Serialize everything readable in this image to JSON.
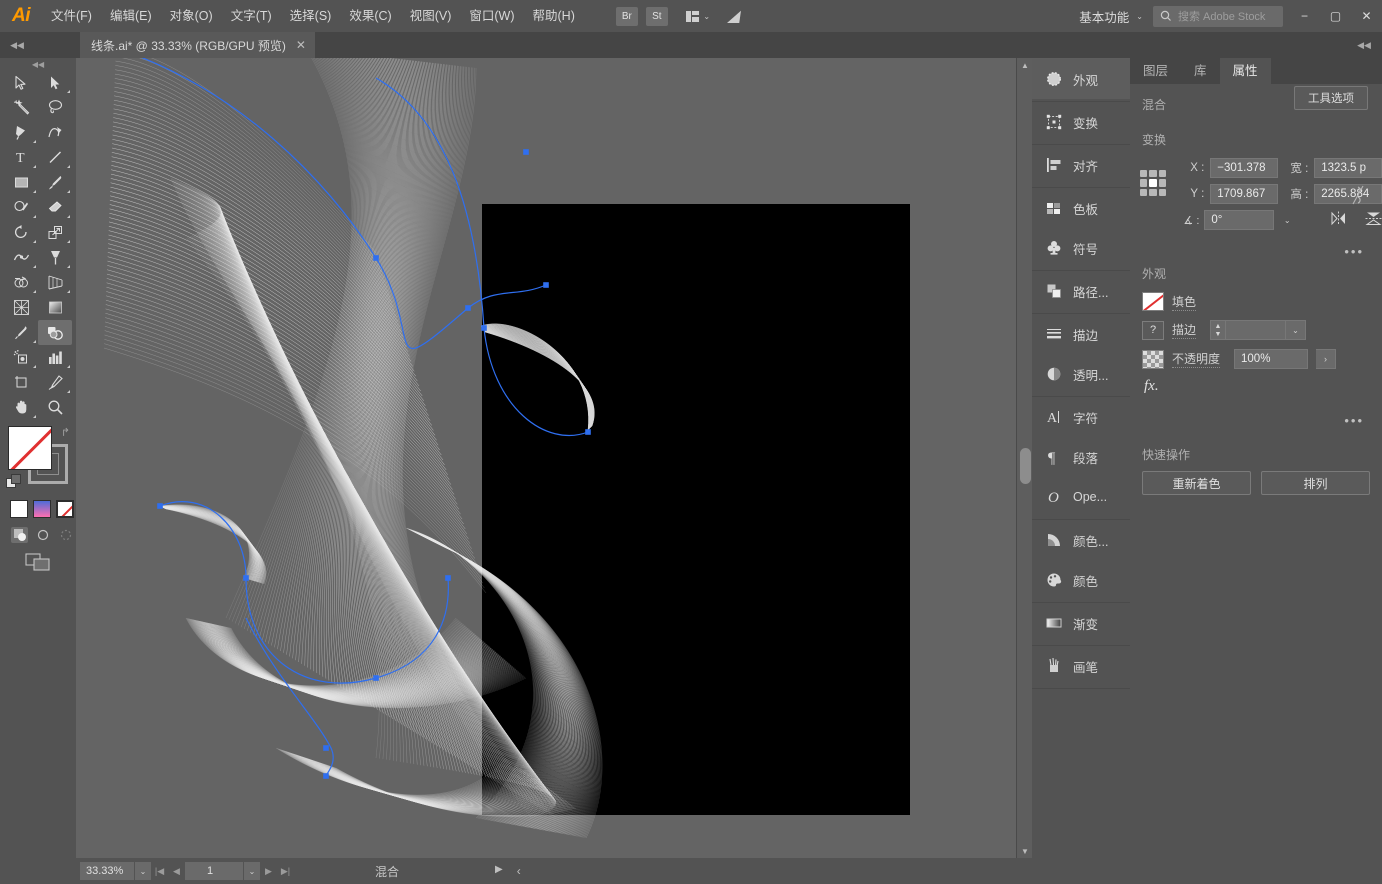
{
  "app": {
    "logo": "Ai"
  },
  "menubar": {
    "items": [
      {
        "label": "文件(F)"
      },
      {
        "label": "编辑(E)"
      },
      {
        "label": "对象(O)"
      },
      {
        "label": "文字(T)"
      },
      {
        "label": "选择(S)"
      },
      {
        "label": "效果(C)"
      },
      {
        "label": "视图(V)"
      },
      {
        "label": "窗口(W)"
      },
      {
        "label": "帮助(H)"
      }
    ],
    "bridge_label": "Br",
    "stock_label": "St",
    "workspace": "基本功能",
    "search_placeholder": "搜索 Adobe Stock",
    "win_minimize": "−",
    "win_maximize": "▢",
    "win_close": "✕"
  },
  "tabbar": {
    "collapse_left": "◀◀",
    "collapse_right": "◀◀",
    "document_title": "线条.ai* @ 33.33% (RGB/GPU 预览)",
    "close_label": "✕"
  },
  "toolbar": {
    "collapse": "◀◀",
    "tools": [
      {
        "name": "selection-tool",
        "glyph": "arrow-solid-nw",
        "submenu": false,
        "selected": false
      },
      {
        "name": "direct-selection-tool",
        "glyph": "arrow-filled",
        "submenu": true,
        "selected": false
      },
      {
        "name": "magic-wand-tool",
        "glyph": "wand",
        "submenu": false,
        "selected": false
      },
      {
        "name": "lasso-tool",
        "glyph": "lasso",
        "submenu": false,
        "selected": false
      },
      {
        "name": "pen-tool",
        "glyph": "pen",
        "submenu": true,
        "selected": false
      },
      {
        "name": "curvature-tool",
        "glyph": "curvature",
        "submenu": false,
        "selected": false
      },
      {
        "name": "type-tool",
        "glyph": "type",
        "submenu": true,
        "selected": false
      },
      {
        "name": "line-segment-tool",
        "glyph": "line",
        "submenu": true,
        "selected": false
      },
      {
        "name": "rectangle-tool",
        "glyph": "rect",
        "submenu": true,
        "selected": false
      },
      {
        "name": "paintbrush-tool",
        "glyph": "brush",
        "submenu": true,
        "selected": false
      },
      {
        "name": "shaper-tool",
        "glyph": "shaper",
        "submenu": true,
        "selected": false
      },
      {
        "name": "eraser-tool",
        "glyph": "eraser",
        "submenu": true,
        "selected": false
      },
      {
        "name": "rotate-tool",
        "glyph": "rotate",
        "submenu": true,
        "selected": false
      },
      {
        "name": "scale-tool",
        "glyph": "scale",
        "submenu": true,
        "selected": false
      },
      {
        "name": "width-tool",
        "glyph": "width",
        "submenu": true,
        "selected": false
      },
      {
        "name": "free-transform-tool",
        "glyph": "pushpin",
        "submenu": true,
        "selected": false
      },
      {
        "name": "shape-builder-tool",
        "glyph": "shapebuilder",
        "submenu": true,
        "selected": false
      },
      {
        "name": "perspective-grid-tool",
        "glyph": "perspective",
        "submenu": true,
        "selected": false
      },
      {
        "name": "mesh-tool",
        "glyph": "mesh",
        "submenu": false,
        "selected": false
      },
      {
        "name": "gradient-tool",
        "glyph": "gradient",
        "submenu": false,
        "selected": false
      },
      {
        "name": "eyedropper-tool",
        "glyph": "eyedropper",
        "submenu": true,
        "selected": false
      },
      {
        "name": "blend-tool",
        "glyph": "blend",
        "submenu": false,
        "selected": true
      },
      {
        "name": "symbol-sprayer-tool",
        "glyph": "symbolspray",
        "submenu": true,
        "selected": false
      },
      {
        "name": "column-graph-tool",
        "glyph": "graph",
        "submenu": true,
        "selected": false
      },
      {
        "name": "artboard-tool",
        "glyph": "artboard",
        "submenu": false,
        "selected": false
      },
      {
        "name": "slice-tool",
        "glyph": "slice",
        "submenu": true,
        "selected": false
      },
      {
        "name": "hand-tool",
        "glyph": "hand",
        "submenu": true,
        "selected": false
      },
      {
        "name": "zoom-tool",
        "glyph": "zoom",
        "submenu": false,
        "selected": false
      }
    ],
    "fill_color": "#ffffff",
    "fill_is_none": true,
    "stroke_is_none": true,
    "swap_icon": "↱",
    "color_modes": [
      {
        "name": "color-mode-white",
        "type": "flat"
      },
      {
        "name": "color-mode-gradient",
        "type": "gradient"
      },
      {
        "name": "color-mode-none",
        "type": "none"
      }
    ],
    "draw_modes": [
      {
        "name": "draw-normal-mode",
        "selected": true
      },
      {
        "name": "draw-behind-mode",
        "selected": false
      },
      {
        "name": "draw-inside-mode",
        "selected": false
      }
    ]
  },
  "canvas": {
    "artboard_background": "#000000",
    "canvas_background": "#646464",
    "path_color": "#2f6ff0",
    "artwork_stroke": "#ffffff"
  },
  "statusbar": {
    "zoom_level": "33.33%",
    "zoom_dropdown": "⌄",
    "page_first": "|◀",
    "page_prev": "◀",
    "page_number": "1",
    "page_dropdown": "⌄",
    "page_next": "▶",
    "page_last": "▶|",
    "tool_status": "混合",
    "play_arrow": "▶",
    "back_arrow": "‹"
  },
  "dock": {
    "groups": [
      {
        "items": [
          {
            "label": "外观",
            "icon": "appearance-icon",
            "active": true
          }
        ]
      },
      {
        "items": [
          {
            "label": "变换",
            "icon": "transform-icon",
            "active": false
          }
        ]
      },
      {
        "items": [
          {
            "label": "对齐",
            "icon": "align-icon",
            "active": false
          }
        ]
      },
      {
        "items": [
          {
            "label": "色板",
            "icon": "swatches-icon",
            "active": false
          },
          {
            "label": "符号",
            "icon": "symbols-icon",
            "active": false
          }
        ]
      },
      {
        "items": [
          {
            "label": "路径...",
            "icon": "pathfinder-icon",
            "active": false
          }
        ]
      },
      {
        "items": [
          {
            "label": "描边",
            "icon": "stroke-icon",
            "active": false
          },
          {
            "label": "透明...",
            "icon": "transparency-icon",
            "active": false
          }
        ]
      },
      {
        "items": [
          {
            "label": "字符",
            "icon": "character-icon",
            "active": false
          },
          {
            "label": "段落",
            "icon": "paragraph-icon",
            "active": false
          },
          {
            "label": "Ope...",
            "icon": "opentype-icon",
            "active": false
          }
        ]
      },
      {
        "items": [
          {
            "label": "颜色...",
            "icon": "color-guide-icon",
            "active": false
          },
          {
            "label": "颜色",
            "icon": "color-icon",
            "active": false
          }
        ]
      },
      {
        "items": [
          {
            "label": "渐变",
            "icon": "gradient-icon",
            "active": false
          }
        ]
      },
      {
        "items": [
          {
            "label": "画笔",
            "icon": "brushes-icon",
            "active": false
          }
        ]
      }
    ]
  },
  "properties": {
    "tabs": [
      {
        "label": "图层",
        "active": false
      },
      {
        "label": "库",
        "active": false
      },
      {
        "label": "属性",
        "active": true
      }
    ],
    "object_type": "混合",
    "tool_options_label": "工具选项",
    "transform": {
      "title": "变换",
      "x_label": "X :",
      "x_value": "−301.378",
      "y_label": "Y :",
      "y_value": "1709.867",
      "w_label": "宽 :",
      "w_value": "1323.5 p",
      "h_label": "高 :",
      "h_value": "2265.884",
      "angle_label": "∡ :",
      "angle_value": "0°",
      "angle_dropdown": "⌄",
      "link_icon": "unlink-icon",
      "flip_h_icon": "flip-horizontal-icon",
      "flip_v_icon": "flip-vertical-icon",
      "more_options": "•••"
    },
    "appearance": {
      "title": "外观",
      "fill_label": "填色",
      "fill_value": "none",
      "stroke_label": "描边",
      "stroke_value": "",
      "stroke_unknown": "?",
      "opacity_label": "不透明度",
      "opacity_value": "100%",
      "opacity_arrow": "›",
      "fx_label": "fx.",
      "more_options": "•••"
    },
    "quick_actions": {
      "title": "快速操作",
      "recolor_label": "重新着色",
      "arrange_label": "排列"
    }
  }
}
